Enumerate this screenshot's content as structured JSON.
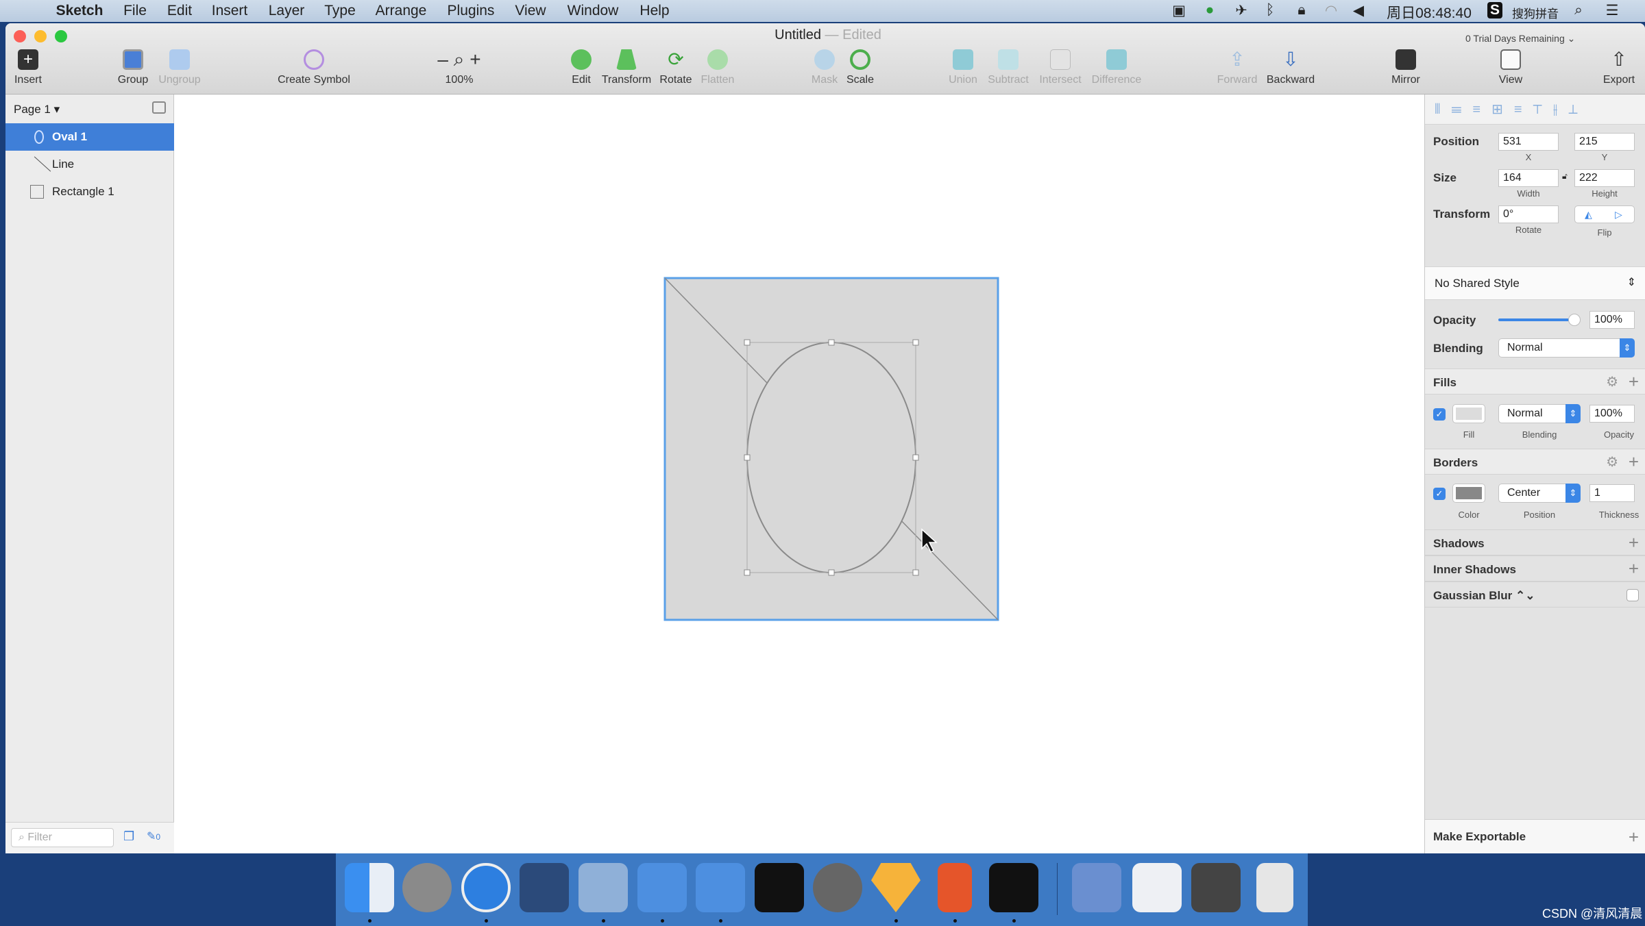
{
  "menubar": {
    "items": [
      "Sketch",
      "File",
      "Edit",
      "Insert",
      "Layer",
      "Type",
      "Arrange",
      "Plugins",
      "View",
      "Window",
      "Help"
    ],
    "clock": "周日08:48:40",
    "input_method": "搜狗拼音"
  },
  "window": {
    "title": "Untitled",
    "edited": "— Edited",
    "trial": "0 Trial Days Remaining ⌄"
  },
  "toolbar": {
    "insert": "Insert",
    "group": "Group",
    "ungroup": "Ungroup",
    "create_symbol": "Create Symbol",
    "zoom": "100%",
    "edit": "Edit",
    "transform": "Transform",
    "rotate": "Rotate",
    "flatten": "Flatten",
    "mask": "Mask",
    "scale": "Scale",
    "union": "Union",
    "subtract": "Subtract",
    "intersect": "Intersect",
    "difference": "Difference",
    "forward": "Forward",
    "backward": "Backward",
    "mirror": "Mirror",
    "view": "View",
    "export": "Export"
  },
  "layers": {
    "page": "Page 1",
    "items": [
      {
        "name": "Oval 1",
        "selected": true
      },
      {
        "name": "Line"
      },
      {
        "name": "Rectangle 1"
      }
    ],
    "filter_placeholder": "Filter",
    "edit_count": "0"
  },
  "inspector": {
    "position": {
      "label": "Position",
      "x": "531",
      "y": "215",
      "x_label": "X",
      "y_label": "Y"
    },
    "size": {
      "label": "Size",
      "width": "164",
      "height": "222",
      "w_label": "Width",
      "h_label": "Height"
    },
    "transform": {
      "label": "Transform",
      "rotate": "0°",
      "rotate_label": "Rotate",
      "flip_label": "Flip"
    },
    "shared_style": "No Shared Style",
    "opacity": {
      "label": "Opacity",
      "value": "100%",
      "fraction": 1.0
    },
    "blending": {
      "label": "Blending",
      "value": "Normal"
    },
    "fills": {
      "title": "Fills",
      "enabled": true,
      "color": "#dcdcdc",
      "blending": "Normal",
      "opacity": "100%",
      "fill_label": "Fill",
      "blending_label": "Blending",
      "opacity_label": "Opacity"
    },
    "borders": {
      "title": "Borders",
      "enabled": true,
      "color": "#888888",
      "position": "Center",
      "thickness": "1",
      "color_label": "Color",
      "position_label": "Position",
      "thickness_label": "Thickness"
    },
    "shadows": "Shadows",
    "inner_shadows": "Inner Shadows",
    "gaussian_blur": "Gaussian Blur ⌃⌄",
    "make_exportable": "Make Exportable"
  },
  "colors": {
    "accent": "#3b86e6",
    "artboard_fill": "#d8d8d8",
    "selection": "#5aa0e8"
  },
  "watermark": "CSDN @清风清晨"
}
